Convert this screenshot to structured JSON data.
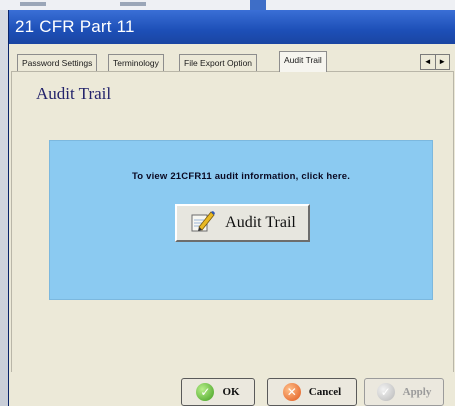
{
  "window": {
    "title": "21 CFR Part 11"
  },
  "tabs": [
    {
      "label": "Password Settings",
      "active": false
    },
    {
      "label": "Terminology",
      "active": false
    },
    {
      "label": "File Export Option",
      "active": false
    },
    {
      "label": "Audit Trail",
      "active": true
    }
  ],
  "tab_scroll": {
    "left": "◄",
    "right": "►"
  },
  "panel": {
    "title": "Audit Trail",
    "info_text": "To view 21CFR11 audit information, click here.",
    "audit_button_label": "Audit Trail",
    "audit_button_icon": "pen-notepad-icon",
    "box_color": "#8bcaf1"
  },
  "buttons": {
    "ok_label": "OK",
    "cancel_label": "Cancel",
    "apply_label": "Apply"
  }
}
